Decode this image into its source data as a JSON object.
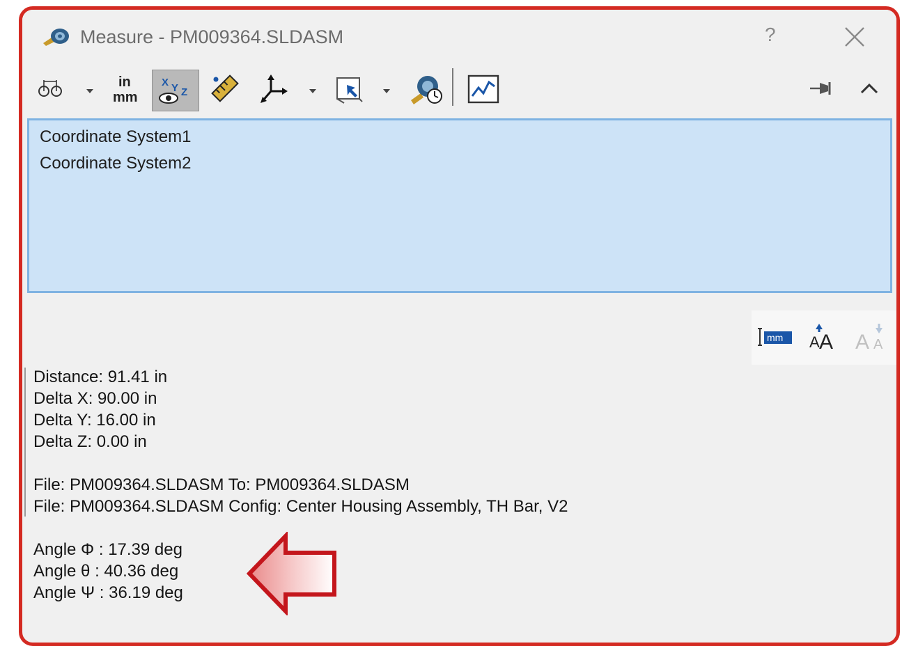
{
  "window": {
    "title": "Measure - PM009364.SLDASM",
    "help_label": "?",
    "close_icon": "close-icon"
  },
  "toolbar": {
    "buttons": [
      {
        "name": "arc-circle-measure",
        "icon": "arc-measure-icon",
        "dropdown": true
      },
      {
        "name": "units-precision",
        "icon": "units-icon",
        "top": "in",
        "bottom": "mm"
      },
      {
        "name": "show-xyz-measurements",
        "icon": "xyz-eye-icon",
        "pressed": true
      },
      {
        "name": "point-to-point",
        "icon": "ruler-icon"
      },
      {
        "name": "projection",
        "icon": "axes-icon",
        "dropdown": true
      },
      {
        "name": "select-coordinate-system",
        "icon": "cursor-select-icon",
        "dropdown": true
      },
      {
        "name": "measure-history",
        "icon": "history-icon"
      },
      {
        "name": "create-sensor",
        "icon": "sensor-graph-icon"
      }
    ],
    "pin_icon": "pin-icon",
    "collapse_icon": "chevron-up-icon"
  },
  "selection": {
    "items": [
      "Coordinate System1",
      "Coordinate System2"
    ]
  },
  "mini_toolbar": {
    "dimension_label": "mm",
    "icons": [
      "insert-dimension-icon",
      "increase-font-icon",
      "decrease-font-icon"
    ]
  },
  "results": {
    "distance": "Distance: 91.41 in",
    "delta_x": "Delta X: 90.00 in",
    "delta_y": "Delta Y: 16.00 in",
    "delta_z": "Delta Z: 0.00 in",
    "file_to": "File: PM009364.SLDASM To: PM009364.SLDASM",
    "file_config": "File: PM009364.SLDASM Config: Center Housing Assembly, TH Bar, V2",
    "angle_phi": "Angle Φ : 17.39 deg",
    "angle_theta": "Angle θ : 40.36 deg",
    "angle_psi": "Angle Ψ : 36.19 deg"
  },
  "annotation": {
    "arrow_icon": "left-arrow-callout-icon",
    "color": "#c4161c"
  }
}
